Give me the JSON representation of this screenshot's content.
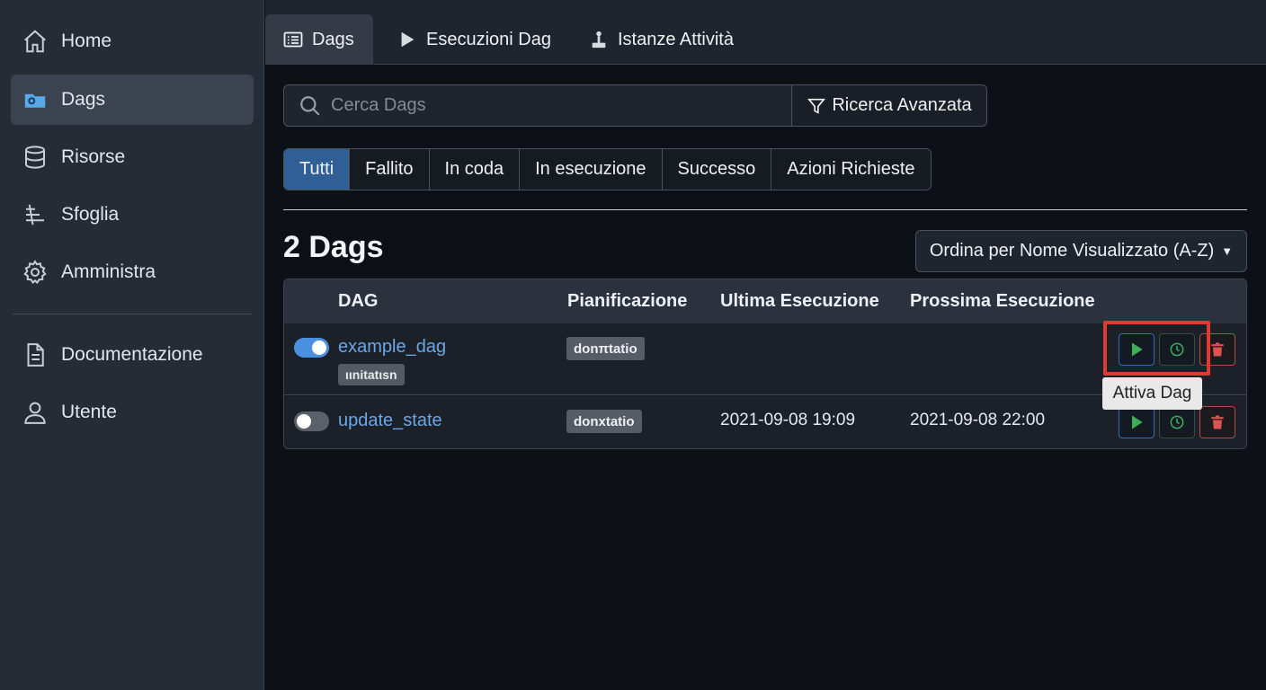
{
  "sidebar": {
    "items": [
      {
        "label": "Home",
        "icon": "home-icon"
      },
      {
        "label": "Dags",
        "icon": "dags-icon",
        "active": true
      },
      {
        "label": "Risorse",
        "icon": "database-icon"
      },
      {
        "label": "Sfoglia",
        "icon": "browse-icon"
      },
      {
        "label": "Amministra",
        "icon": "gear-icon"
      },
      {
        "label": "Documentazione",
        "icon": "document-icon"
      },
      {
        "label": "Utente",
        "icon": "user-icon"
      }
    ]
  },
  "topnav": {
    "tabs": [
      {
        "label": "Dags",
        "icon": "list-icon",
        "active": true
      },
      {
        "label": "Esecuzioni Dag",
        "icon": "play-icon"
      },
      {
        "label": "Istanze Attività",
        "icon": "task-icon"
      }
    ]
  },
  "search": {
    "placeholder": "Cerca Dags",
    "value": "",
    "advanced_label": "Ricerca Avanzata"
  },
  "filters": [
    "Tutti",
    "Fallito",
    "In coda",
    "In esecuzione",
    "Successo",
    "Azioni Richieste"
  ],
  "active_filter": "Tutti",
  "summary": {
    "count_title": "2 Dags",
    "sort_label": "Ordina per Nome Visualizzato (A-Z)"
  },
  "table": {
    "headers": [
      "DAG",
      "Pianificazione",
      "Ultima Esecuzione",
      "Prossima Esecuzione"
    ],
    "rows": [
      {
        "enabled": true,
        "name": "example_dag",
        "tag": "ιιnitatιsn",
        "schedule": "donπtatio",
        "last_run": "",
        "next_run": ""
      },
      {
        "enabled": false,
        "name": "update_state",
        "tag": "",
        "schedule": "donxtatio",
        "last_run": "2021-09-08 19:09",
        "next_run": "2021-09-08 22:00"
      }
    ]
  },
  "tooltip": "Attiva Dag",
  "colors": {
    "accent": "#2f5f95",
    "link": "#6aa7e6",
    "run_green": "#3fae5a",
    "delete_red": "#e05252",
    "highlight": "#e03b2e"
  }
}
